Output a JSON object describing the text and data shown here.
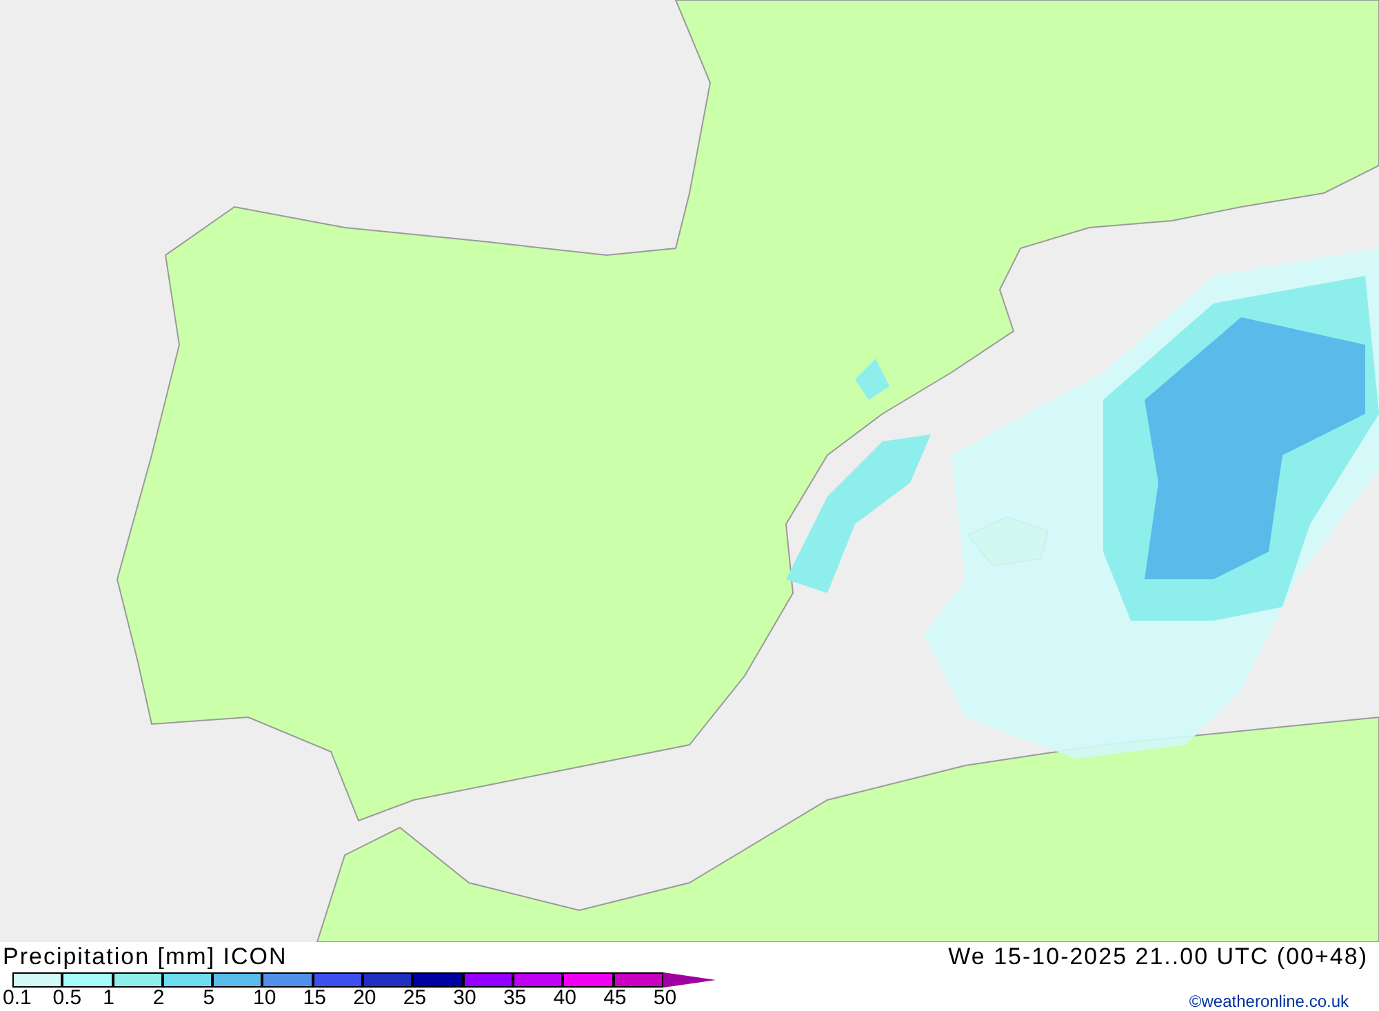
{
  "map": {
    "title": "Precipitation [mm] ICON",
    "valid_time": "We 15-10-2025 21..00 UTC (00+48)",
    "credit": "©weatheronline.co.uk"
  },
  "scale": [
    {
      "label": "0.1",
      "color": "#d2f8f8"
    },
    {
      "label": "0.5",
      "color": "#a6fcfc"
    },
    {
      "label": "1",
      "color": "#8eeeec"
    },
    {
      "label": "2",
      "color": "#6edcf0"
    },
    {
      "label": "5",
      "color": "#5abaea"
    },
    {
      "label": "10",
      "color": "#5090e8"
    },
    {
      "label": "15",
      "color": "#3c50f0"
    },
    {
      "label": "20",
      "color": "#2030c0"
    },
    {
      "label": "25",
      "color": "#0000a0"
    },
    {
      "label": "30",
      "color": "#9400ff"
    },
    {
      "label": "35",
      "color": "#c000f0"
    },
    {
      "label": "40",
      "color": "#f000f0"
    },
    {
      "label": "45",
      "color": "#c800c0"
    },
    {
      "label": "50",
      "color": "#a000a0"
    }
  ]
}
